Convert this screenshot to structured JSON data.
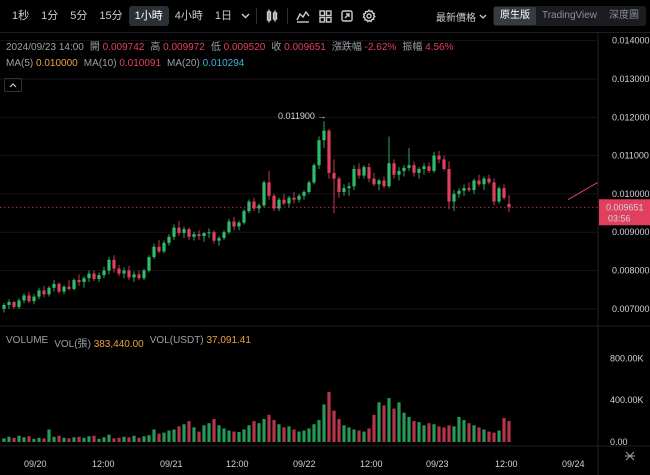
{
  "toolbar": {
    "intervals": [
      "1秒",
      "1分",
      "5分",
      "15分",
      "1小時",
      "4小時",
      "1日"
    ],
    "active_interval": "1小時",
    "price_select": "最新價格",
    "views": [
      "原生版",
      "TradingView",
      "深度圖"
    ],
    "active_view": "原生版"
  },
  "legend": {
    "datetime": "2024/09/23 14:00",
    "open_label": "開",
    "open": "0.009742",
    "high_label": "高",
    "high": "0.009972",
    "low_label": "低",
    "low": "0.009520",
    "close_label": "收",
    "close": "0.009651",
    "change_label": "漲跌幅",
    "change": "-2.62%",
    "amp_label": "振幅",
    "amp": "4.56%",
    "ma5_label": "MA(5)",
    "ma5": "0.010000",
    "ma10_label": "MA(10)",
    "ma10": "0.010091",
    "ma20_label": "MA(20)",
    "ma20": "0.010294"
  },
  "volume_legend": {
    "label": "VOLUME",
    "vol_label": "VOL(張)",
    "vol": "383,440.00",
    "usdt_label": "VOL(USDT)",
    "usdt": "37,091.41"
  },
  "price_axis": [
    "0.014000",
    "0.013000",
    "0.012000",
    "0.011000",
    "0.010000",
    "0.009000",
    "0.008000",
    "0.007000"
  ],
  "volume_axis": [
    "800.00K",
    "400.00K",
    "0.00"
  ],
  "time_axis": [
    "09/20",
    "12:00",
    "09/21",
    "12:00",
    "09/22",
    "12:00",
    "09/23",
    "12:00",
    "09/24"
  ],
  "current_price": {
    "value": "0.009651",
    "countdown": "03:56"
  },
  "high_marker": "0.011900 →",
  "colors": {
    "up": "#2ebd68",
    "down": "#e0405e",
    "bg": "#000000"
  },
  "chart_data": {
    "type": "candlestick",
    "interval": "1h",
    "ylim": [
      0.0065,
      0.0142
    ],
    "candles": [
      [
        0.007,
        0.00715,
        0.0069,
        0.0071
      ],
      [
        0.0071,
        0.00725,
        0.007,
        0.00718
      ],
      [
        0.00718,
        0.0072,
        0.007,
        0.00705
      ],
      [
        0.00705,
        0.00728,
        0.007,
        0.00722
      ],
      [
        0.00722,
        0.0074,
        0.00715,
        0.00735
      ],
      [
        0.00735,
        0.00745,
        0.00715,
        0.0072
      ],
      [
        0.0072,
        0.00738,
        0.00712,
        0.00732
      ],
      [
        0.00732,
        0.00755,
        0.00725,
        0.00748
      ],
      [
        0.00748,
        0.0076,
        0.0073,
        0.00738
      ],
      [
        0.00738,
        0.0076,
        0.00732,
        0.00755
      ],
      [
        0.00755,
        0.00775,
        0.00745,
        0.00765
      ],
      [
        0.00765,
        0.0077,
        0.0074,
        0.00745
      ],
      [
        0.00745,
        0.00762,
        0.00738,
        0.00758
      ],
      [
        0.00758,
        0.00775,
        0.00748,
        0.00752
      ],
      [
        0.00752,
        0.0078,
        0.00748,
        0.00775
      ],
      [
        0.00775,
        0.0079,
        0.0076,
        0.0077
      ],
      [
        0.0077,
        0.00785,
        0.00755,
        0.0078
      ],
      [
        0.0078,
        0.008,
        0.0077,
        0.00792
      ],
      [
        0.00792,
        0.008,
        0.00772,
        0.00778
      ],
      [
        0.00778,
        0.00795,
        0.0077,
        0.00788
      ],
      [
        0.00788,
        0.0081,
        0.0078,
        0.008
      ],
      [
        0.008,
        0.00835,
        0.0079,
        0.00828
      ],
      [
        0.00828,
        0.0084,
        0.00795,
        0.00805
      ],
      [
        0.00805,
        0.00815,
        0.00785,
        0.00792
      ],
      [
        0.00792,
        0.00808,
        0.0078,
        0.008
      ],
      [
        0.008,
        0.00812,
        0.00775,
        0.00782
      ],
      [
        0.00782,
        0.00798,
        0.0077,
        0.0079
      ],
      [
        0.0079,
        0.008,
        0.00775,
        0.0078
      ],
      [
        0.0078,
        0.00805,
        0.00775,
        0.008
      ],
      [
        0.008,
        0.0084,
        0.00795,
        0.00835
      ],
      [
        0.00835,
        0.0087,
        0.0083,
        0.00862
      ],
      [
        0.00862,
        0.0088,
        0.00845,
        0.0085
      ],
      [
        0.0085,
        0.00878,
        0.00845,
        0.00872
      ],
      [
        0.00872,
        0.00895,
        0.00865,
        0.00888
      ],
      [
        0.00888,
        0.0092,
        0.0088,
        0.00912
      ],
      [
        0.00912,
        0.0093,
        0.0089,
        0.00898
      ],
      [
        0.00898,
        0.00915,
        0.00885,
        0.00908
      ],
      [
        0.00908,
        0.00912,
        0.0088,
        0.00888
      ],
      [
        0.00888,
        0.00902,
        0.00878,
        0.00895
      ],
      [
        0.00895,
        0.00905,
        0.0088,
        0.0089
      ],
      [
        0.0089,
        0.009,
        0.00875,
        0.00898
      ],
      [
        0.00898,
        0.0091,
        0.00885,
        0.009
      ],
      [
        0.009,
        0.00905,
        0.0087,
        0.00878
      ],
      [
        0.00878,
        0.0089,
        0.00865,
        0.00885
      ],
      [
        0.00885,
        0.00905,
        0.0088,
        0.009
      ],
      [
        0.009,
        0.00935,
        0.00895,
        0.00928
      ],
      [
        0.00928,
        0.0094,
        0.00905,
        0.00915
      ],
      [
        0.00915,
        0.0093,
        0.00905,
        0.00925
      ],
      [
        0.00925,
        0.0096,
        0.0092,
        0.00955
      ],
      [
        0.00955,
        0.00985,
        0.0095,
        0.0098
      ],
      [
        0.0098,
        0.0099,
        0.00955,
        0.00962
      ],
      [
        0.00962,
        0.00975,
        0.0095,
        0.0097
      ],
      [
        0.0097,
        0.01035,
        0.00965,
        0.0103
      ],
      [
        0.0103,
        0.0106,
        0.00985,
        0.00995
      ],
      [
        0.00995,
        0.01,
        0.00955,
        0.00962
      ],
      [
        0.00962,
        0.0099,
        0.00955,
        0.00985
      ],
      [
        0.00985,
        0.01,
        0.0097,
        0.00975
      ],
      [
        0.00975,
        0.00995,
        0.00965,
        0.0099
      ],
      [
        0.0099,
        0.01005,
        0.00975,
        0.00985
      ],
      [
        0.00985,
        0.01,
        0.00978,
        0.00995
      ],
      [
        0.00995,
        0.0101,
        0.00985,
        0.01005
      ],
      [
        0.01005,
        0.01035,
        0.01,
        0.0103
      ],
      [
        0.0103,
        0.0108,
        0.01025,
        0.01075
      ],
      [
        0.01075,
        0.0115,
        0.01065,
        0.0114
      ],
      [
        0.0114,
        0.0119,
        0.0112,
        0.01165
      ],
      [
        0.01165,
        0.0117,
        0.0104,
        0.01055
      ],
      [
        0.01055,
        0.0109,
        0.0095,
        0.0104
      ],
      [
        0.0104,
        0.01045,
        0.0099,
        0.01005
      ],
      [
        0.01005,
        0.01025,
        0.00995,
        0.01015
      ],
      [
        0.01015,
        0.0103,
        0.00995,
        0.0102
      ],
      [
        0.0102,
        0.01075,
        0.0101,
        0.01065
      ],
      [
        0.01065,
        0.0108,
        0.0104,
        0.01048
      ],
      [
        0.01048,
        0.01075,
        0.0104,
        0.0107
      ],
      [
        0.0107,
        0.0108,
        0.0103,
        0.0104
      ],
      [
        0.0104,
        0.01055,
        0.0102,
        0.01025
      ],
      [
        0.01025,
        0.0104,
        0.0101,
        0.01035
      ],
      [
        0.01035,
        0.01045,
        0.01015,
        0.0102
      ],
      [
        0.0102,
        0.0115,
        0.01015,
        0.0108
      ],
      [
        0.0108,
        0.0109,
        0.0104,
        0.0105
      ],
      [
        0.0105,
        0.0107,
        0.01035,
        0.0106
      ],
      [
        0.0106,
        0.01075,
        0.01045,
        0.01068
      ],
      [
        0.01068,
        0.0112,
        0.0106,
        0.01075
      ],
      [
        0.01075,
        0.01085,
        0.01045,
        0.01055
      ],
      [
        0.01055,
        0.0107,
        0.0104,
        0.01065
      ],
      [
        0.01065,
        0.0108,
        0.0105,
        0.01072
      ],
      [
        0.01072,
        0.01082,
        0.01055,
        0.0106
      ],
      [
        0.0106,
        0.0111,
        0.01055,
        0.011
      ],
      [
        0.011,
        0.01112,
        0.0108,
        0.0109
      ],
      [
        0.0109,
        0.011,
        0.0106,
        0.01065
      ],
      [
        0.01065,
        0.01085,
        0.0096,
        0.0098
      ],
      [
        0.0098,
        0.0101,
        0.00955,
        0.01
      ],
      [
        0.01,
        0.01015,
        0.0099,
        0.01008
      ],
      [
        0.01008,
        0.01025,
        0.00995,
        0.01015
      ],
      [
        0.01015,
        0.0103,
        0.01005,
        0.0101
      ],
      [
        0.0101,
        0.0104,
        0.01,
        0.01035
      ],
      [
        0.01035,
        0.0105,
        0.0102,
        0.01025
      ],
      [
        0.01025,
        0.01045,
        0.0101,
        0.0104
      ],
      [
        0.0104,
        0.0105,
        0.01025,
        0.0103
      ],
      [
        0.0103,
        0.0104,
        0.0097,
        0.0098
      ],
      [
        0.0098,
        0.0102,
        0.00975,
        0.01015
      ],
      [
        0.01015,
        0.01025,
        0.00985,
        0.0099
      ],
      [
        0.00974,
        0.00997,
        0.00952,
        0.00965
      ]
    ],
    "volumes_k": [
      35,
      50,
      40,
      60,
      45,
      55,
      30,
      40,
      35,
      120,
      50,
      60,
      40,
      35,
      45,
      50,
      40,
      55,
      60,
      30,
      45,
      70,
      35,
      40,
      50,
      45,
      60,
      40,
      55,
      65,
      120,
      80,
      90,
      110,
      120,
      150,
      170,
      200,
      140,
      100,
      160,
      180,
      220,
      160,
      130,
      110,
      100,
      95,
      120,
      160,
      200,
      180,
      220,
      260,
      210,
      170,
      140,
      150,
      120,
      100,
      110,
      130,
      170,
      210,
      360,
      480,
      300,
      220,
      160,
      140,
      120,
      110,
      100,
      130,
      260,
      380,
      350,
      420,
      320,
      380,
      280,
      240,
      200,
      190,
      160,
      180,
      170,
      150,
      140,
      160,
      150,
      240,
      210,
      180,
      160,
      140,
      120,
      100,
      90,
      110,
      230,
      200,
      380
    ]
  }
}
